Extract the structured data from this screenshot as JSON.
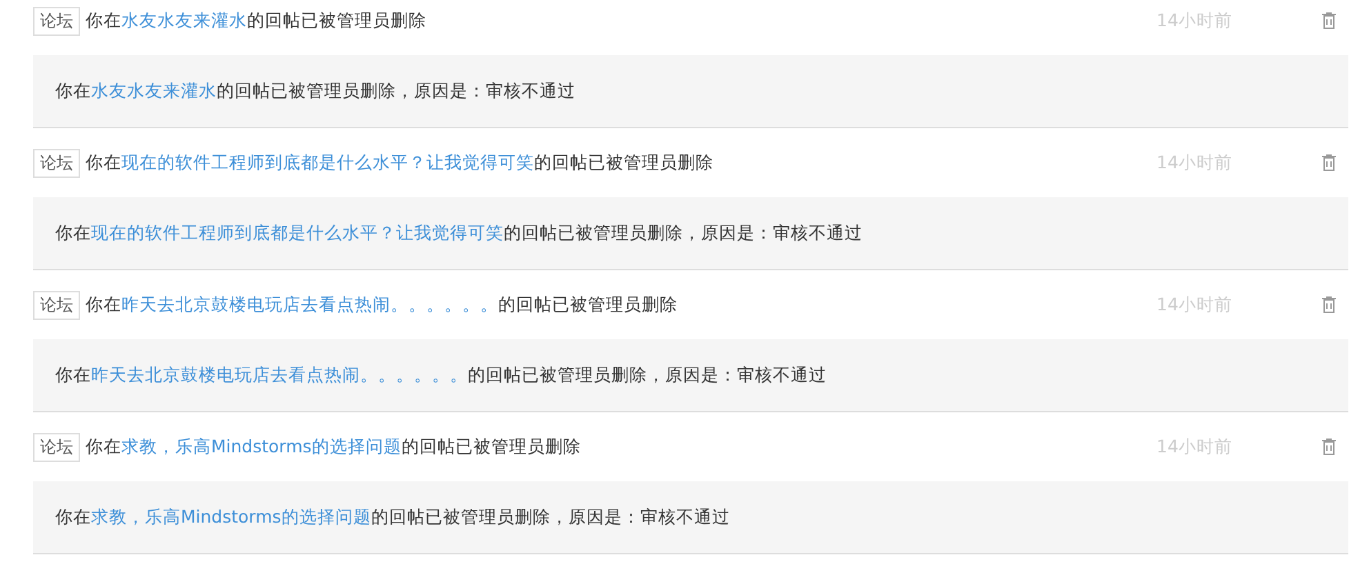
{
  "notices": [
    {
      "tag": "论坛",
      "prefix": "你在",
      "link": "水友水友来灌水",
      "suffix": "的回帖已被管理员删除",
      "time": "14小时前",
      "detail_prefix": "你在",
      "detail_link": "水友水友来灌水",
      "detail_suffix": "的回帖已被管理员删除，原因是：审核不通过"
    },
    {
      "tag": "论坛",
      "prefix": "你在",
      "link": "现在的软件工程师到底都是什么水平？让我觉得可笑",
      "suffix": "的回帖已被管理员删除",
      "time": "14小时前",
      "detail_prefix": "你在",
      "detail_link": "现在的软件工程师到底都是什么水平？让我觉得可笑",
      "detail_suffix": "的回帖已被管理员删除，原因是：审核不通过"
    },
    {
      "tag": "论坛",
      "prefix": "你在",
      "link": "昨天去北京鼓楼电玩店去看点热闹。。。。。。",
      "suffix": "的回帖已被管理员删除",
      "time": "14小时前",
      "detail_prefix": "你在",
      "detail_link": "昨天去北京鼓楼电玩店去看点热闹。。。。。。",
      "detail_suffix": "的回帖已被管理员删除，原因是：审核不通过"
    },
    {
      "tag": "论坛",
      "prefix": "你在",
      "link": "求教，乐高Mindstorms的选择问题",
      "suffix": "的回帖已被管理员删除",
      "time": "14小时前",
      "detail_prefix": "你在",
      "detail_link": "求教，乐高Mindstorms的选择问题",
      "detail_suffix": "的回帖已被管理员删除，原因是：审核不通过"
    }
  ]
}
